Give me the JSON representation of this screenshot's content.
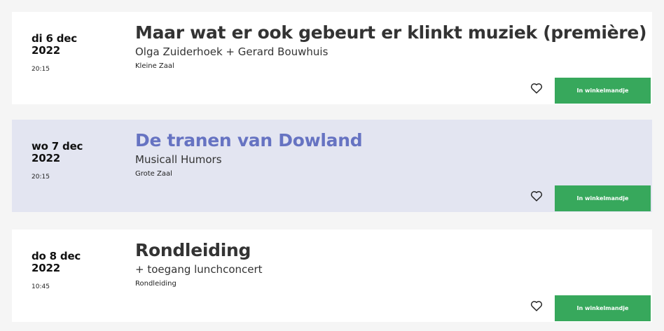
{
  "events": [
    {
      "date_day": "di 6 dec",
      "date_year": "2022",
      "time": "20:15",
      "title": "Maar wat er ook gebeurt er klinkt muziek (première)",
      "subtitle": "Olga Zuiderhoek + Gerard Bouwhuis",
      "venue": "Kleine Zaal",
      "cart_label": "In winkelmandje",
      "favorite_icon": "heart-outline-icon"
    },
    {
      "date_day": "wo 7 dec",
      "date_year": "2022",
      "time": "20:15",
      "title": "De tranen van Dowland",
      "subtitle": "Musicall Humors",
      "venue": "Grote Zaal",
      "cart_label": "In winkelmandje",
      "favorite_icon": "heart-outline-icon",
      "highlighted": true
    },
    {
      "date_day": "do 8 dec",
      "date_year": "2022",
      "time": "10:45",
      "title": "Rondleiding",
      "subtitle": "+ toegang lunchconcert",
      "venue": "Rondleiding",
      "cart_label": "In winkelmandje",
      "favorite_icon": "heart-outline-icon"
    }
  ],
  "colors": {
    "page_background": "#f5f5f5",
    "card_background": "#ffffff",
    "highlight_background": "#e3e5f1",
    "highlight_title": "#6673c2",
    "cart_button": "#37a85c"
  }
}
